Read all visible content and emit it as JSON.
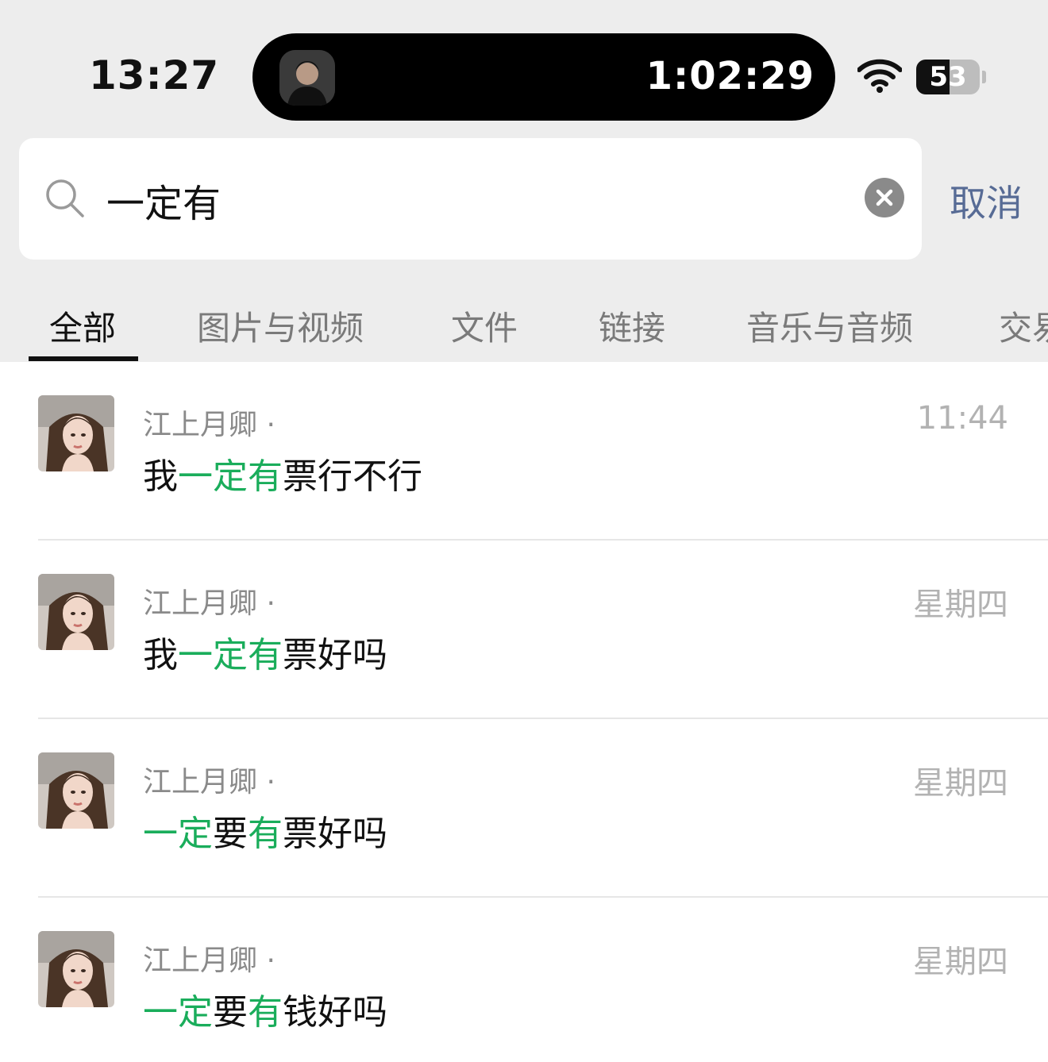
{
  "status_bar": {
    "time": "13:27",
    "timer": "1:02:29",
    "battery": "53",
    "battery_level": 0.53
  },
  "search": {
    "query": "一定有",
    "cancel_label": "取消"
  },
  "tabs": [
    {
      "label": "全部",
      "active": true
    },
    {
      "label": "图片与视频",
      "active": false
    },
    {
      "label": "文件",
      "active": false
    },
    {
      "label": "链接",
      "active": false
    },
    {
      "label": "音乐与音频",
      "active": false
    },
    {
      "label": "交易",
      "active": false
    }
  ],
  "results": [
    {
      "sender": "江上月卿 ·",
      "time": "11:44",
      "message": [
        {
          "t": "我",
          "hl": false
        },
        {
          "t": "一定有",
          "hl": true
        },
        {
          "t": "票行不行",
          "hl": false
        }
      ]
    },
    {
      "sender": "江上月卿 ·",
      "time": "星期四",
      "message": [
        {
          "t": "我",
          "hl": false
        },
        {
          "t": "一定有",
          "hl": true
        },
        {
          "t": "票好吗",
          "hl": false
        }
      ]
    },
    {
      "sender": "江上月卿 ·",
      "time": "星期四",
      "message": [
        {
          "t": "一定",
          "hl": true
        },
        {
          "t": "要",
          "hl": false
        },
        {
          "t": "有",
          "hl": true
        },
        {
          "t": "票好吗",
          "hl": false
        }
      ]
    },
    {
      "sender": "江上月卿 ·",
      "time": "星期四",
      "message": [
        {
          "t": "一定",
          "hl": true
        },
        {
          "t": "要",
          "hl": false
        },
        {
          "t": "有",
          "hl": true
        },
        {
          "t": "钱好吗",
          "hl": false
        }
      ]
    }
  ],
  "colors": {
    "highlight": "#1aad5b",
    "cancel": "#576b95",
    "background": "#ededed"
  }
}
